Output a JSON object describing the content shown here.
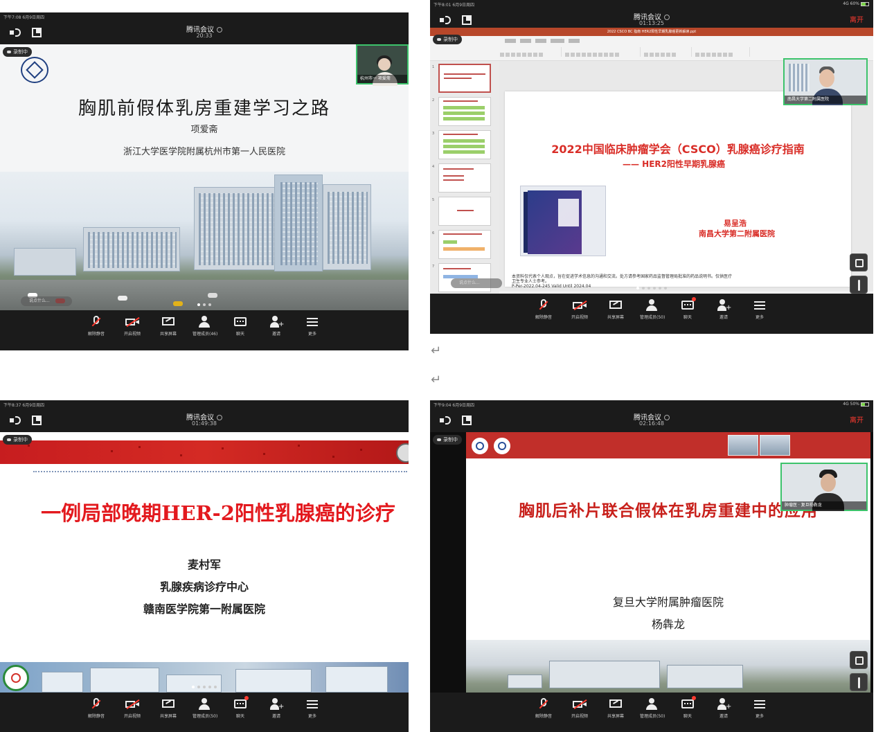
{
  "app": "腾讯会议",
  "common": {
    "recording": "录制中",
    "comment_placeholder": "说点什么...",
    "leave": "离开",
    "toolbar": [
      "解除静音",
      "开启视频",
      "共享屏幕",
      "管理成员(46)",
      "聊天",
      "邀请",
      "更多"
    ],
    "toolbar_50": [
      "解除静音",
      "开启视频",
      "共享屏幕",
      "管理成员(50)",
      "聊天",
      "邀请",
      "更多"
    ]
  },
  "shot1": {
    "status_time": "下午7:08  6月9日周四",
    "meeting_time": "20:33",
    "self_name": "杭州市一 项爱斋",
    "slide": {
      "title": "胸肌前假体乳房重建学习之路",
      "author": "项爱斋",
      "affiliation": "浙江大学医学院附属杭州市第一人民医院"
    }
  },
  "shot2": {
    "status_time": "下午8:01  6月9日周四",
    "status_right": "4G 60%",
    "meeting_time": "01:13:25",
    "self_name": "南昌大学第二附属医院",
    "ppt_filename": "2022 CSCO BC 指南 HER2阳性早期乳腺癌更新解读.ppt",
    "slide": {
      "title": "2022中国临床肿瘤学会（CSCO）乳腺癌诊疗指南",
      "subtitle": "—— HER2阳性早期乳腺癌",
      "book_text": "乳腺癌诊疗指南 2022",
      "author": "易呈浩",
      "hospital": "南昌大学第二附属医院",
      "disclaimer": "本资料仅代表个人观点，旨在促进学术信息的沟通和交流。处方请参考国家药品监督管理局批准的药品说明书。仅供医疗卫生专业人士参考。",
      "code": "P-Per-2022.04-245 Valid Until 2024.04"
    },
    "thumb_numbers": [
      "1",
      "2",
      "3",
      "4",
      "5",
      "6",
      "7"
    ]
  },
  "shot3": {
    "status_time": "下午8:37  6月9日周四",
    "meeting_time": "01:49:38",
    "slide": {
      "title": "一例局部晚期HER-2阳性乳腺癌的诊疗",
      "author": "麦村军",
      "department": "乳腺疾病诊疗中心",
      "hospital": "赣南医学院第一附属医院"
    }
  },
  "shot4": {
    "status_time": "下午9:04  6月9日周四",
    "status_right": "4G 50%",
    "meeting_time": "02:16:48",
    "self_name": "肿瘤医 · 复旦杨犇龙",
    "slide": {
      "title": "胸肌后补片联合假体在乳房重建中的应用",
      "hospital": "复旦大学附属肿瘤医院",
      "author": "杨犇龙"
    }
  },
  "return_mark": "↵",
  "colors": {
    "accent_red": "#ff3b30",
    "active_border": "#3cc36b",
    "slide_red": "#d92d27"
  }
}
